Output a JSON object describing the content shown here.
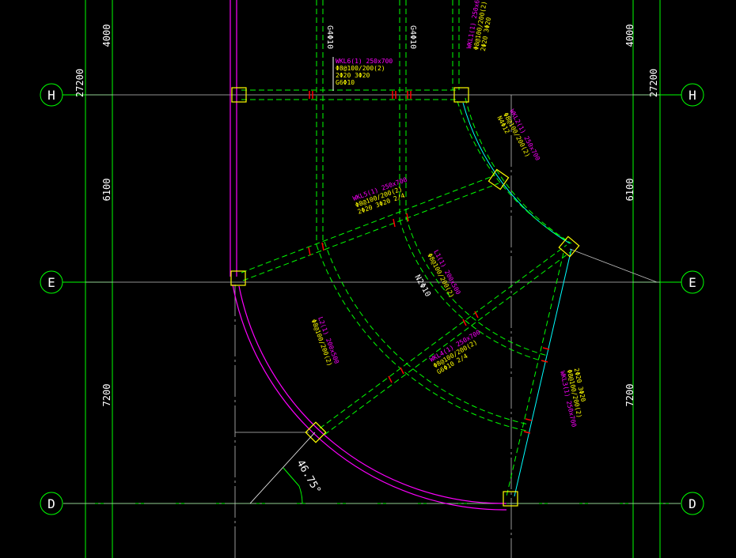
{
  "colors": {
    "background": "#000000",
    "grid_line": "#00ff00",
    "axis_line": "#bfbfbf",
    "beam_dashed": "#00ff00",
    "beam_solid": "#00cc00",
    "wall_magenta": "#ff00ff",
    "cyan_edge": "#00ffff",
    "column": "#ffff00",
    "annot_yellow": "#ffff00",
    "annot_magenta": "#ff00ff",
    "rebar_red": "#ff0000",
    "white": "#ffffff"
  },
  "axes": {
    "rows": [
      {
        "id": "row-H",
        "label": "H"
      },
      {
        "id": "row-E",
        "label": "E"
      },
      {
        "id": "row-D",
        "label": "D"
      }
    ]
  },
  "dimensions": {
    "left": [
      "4000",
      "6100",
      "7200"
    ],
    "left_total": "27200",
    "right": [
      "4000",
      "6100",
      "7200"
    ],
    "right_total": "27200"
  },
  "angle_label": "46.75°",
  "beam_labels": [
    {
      "id": "bl1",
      "lines": [
        "WKL6(1) 250x700",
        "Φ8@100/200(2)",
        "2Φ20 3Φ20",
        "G6Φ10"
      ]
    },
    {
      "id": "bl2",
      "lines": [
        "WKL5(1) 250x700",
        "Φ8@100/200(2)",
        "2Φ20 3Φ20 2/4"
      ]
    },
    {
      "id": "bl3",
      "lines": [
        "L1(1) 200x500",
        "Φ8@100/200(2)",
        "N2Φ10"
      ]
    },
    {
      "id": "bl4",
      "lines": [
        "L2(1) 200x500",
        "Φ8@100/200(2)"
      ]
    },
    {
      "id": "bl5",
      "lines": [
        "WKL4(1) 250x700",
        "Φ8@100/200(2)",
        "G6Φ10 2/4"
      ]
    },
    {
      "id": "bl6",
      "lines": [
        "WKL3(1) 250x700",
        "Φ8@100/200(2)",
        "2Φ20 3Φ20"
      ]
    },
    {
      "id": "bl7",
      "lines": [
        "WKL2(1) 250x700",
        "Φ8@100/200(2)",
        "N4Φ12"
      ]
    },
    {
      "id": "bl8",
      "lines": [
        "WKL1(1) 250x600",
        "Φ8@100/200(2)",
        "2Φ20 3Φ20"
      ]
    }
  ],
  "vertical_notes": [
    "G4Φ10",
    "G4Φ10",
    "N2Φ10"
  ]
}
